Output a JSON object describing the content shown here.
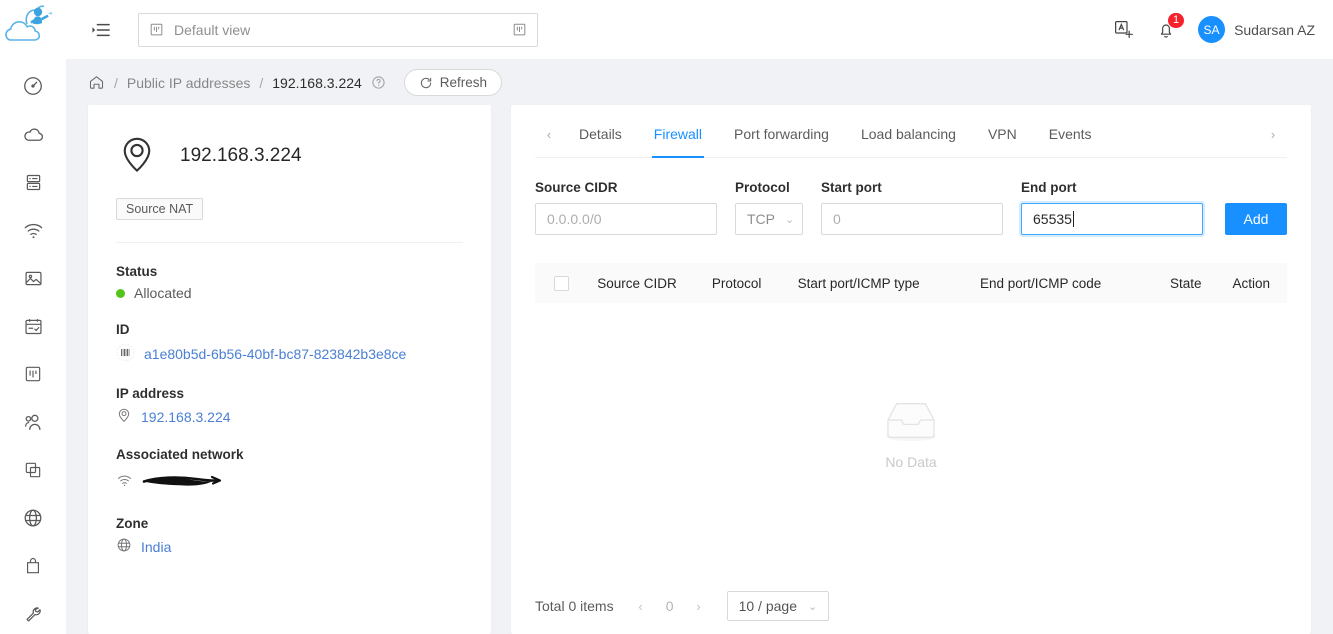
{
  "brand": {
    "accent": "#1890ff",
    "badge_color": "#f5222d",
    "status_green": "#52c41a"
  },
  "topbar": {
    "view_selector_value": "Default view",
    "notification_count": "1",
    "user_initials": "SA",
    "user_name": "Sudarsan AZ"
  },
  "breadcrumb": {
    "home": "home-icon",
    "parent": "Public IP addresses",
    "current": "192.168.3.224",
    "refresh_label": "Refresh"
  },
  "sidebar": {
    "items": [
      {
        "name": "dashboard",
        "icon": "dashboard-icon"
      },
      {
        "name": "compute",
        "icon": "cloud-icon"
      },
      {
        "name": "storage",
        "icon": "database-icon"
      },
      {
        "name": "network",
        "icon": "wifi-icon"
      },
      {
        "name": "images",
        "icon": "picture-icon"
      },
      {
        "name": "events",
        "icon": "calendar-icon"
      },
      {
        "name": "projects",
        "icon": "project-icon"
      },
      {
        "name": "accounts",
        "icon": "users-icon"
      },
      {
        "name": "domains",
        "icon": "copy-icon"
      },
      {
        "name": "infrastructure",
        "icon": "globe-icon"
      },
      {
        "name": "offerings",
        "icon": "bag-icon"
      },
      {
        "name": "tools",
        "icon": "wrench-icon"
      }
    ]
  },
  "detail": {
    "title": "192.168.3.224",
    "tag": "Source NAT",
    "fields": [
      {
        "label": "Status",
        "value": "Allocated",
        "kind": "status"
      },
      {
        "label": "ID",
        "value": "a1e80b5d-6b56-40bf-bc87-823842b3e8ce",
        "kind": "link",
        "icon": "barcode-icon"
      },
      {
        "label": "IP address",
        "value": "192.168.3.224",
        "kind": "link",
        "icon": "pin-icon"
      },
      {
        "label": "Associated network",
        "value": "",
        "kind": "redacted",
        "icon": "wifi-icon"
      },
      {
        "label": "Zone",
        "value": "India",
        "kind": "link",
        "icon": "globe-icon"
      }
    ]
  },
  "tabs": {
    "prev_arrow": "‹",
    "next_arrow": "›",
    "items": [
      {
        "label": "Details",
        "active": false
      },
      {
        "label": "Firewall",
        "active": true
      },
      {
        "label": "Port forwarding",
        "active": false
      },
      {
        "label": "Load balancing",
        "active": false
      },
      {
        "label": "VPN",
        "active": false
      },
      {
        "label": "Events",
        "active": false
      }
    ]
  },
  "form": {
    "source_cidr": {
      "label": "Source CIDR",
      "value": "",
      "placeholder": "0.0.0.0/0"
    },
    "protocol": {
      "label": "Protocol",
      "value": "TCP"
    },
    "start_port": {
      "label": "Start port",
      "value": "",
      "placeholder": "0"
    },
    "end_port": {
      "label": "End port",
      "value": "65535",
      "placeholder": ""
    },
    "add_button": "Add"
  },
  "table": {
    "columns": [
      "Source CIDR",
      "Protocol",
      "Start port/ICMP type",
      "End port/ICMP code",
      "State",
      "Action"
    ],
    "rows": [],
    "empty_text": "No Data"
  },
  "pagination": {
    "total": "Total 0 items",
    "prev": "‹",
    "page": "0",
    "next": "›",
    "page_size": "10 / page"
  }
}
